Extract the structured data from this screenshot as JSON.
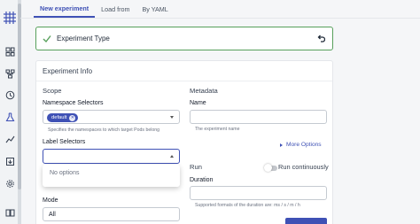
{
  "rail": {
    "icons": [
      "logo-grid-icon",
      "dashboard-icon",
      "workflow-icon",
      "schedule-icon",
      "flask-icon",
      "chart-line-icon",
      "archive-icon",
      "gear-icon",
      "book-icon"
    ]
  },
  "tabs": [
    {
      "label": "New experiment",
      "active": true
    },
    {
      "label": "Load from",
      "active": false
    },
    {
      "label": "By YAML",
      "active": false
    }
  ],
  "step": {
    "title": "Experiment Type"
  },
  "info": {
    "heading": "Experiment Info",
    "scope": {
      "heading": "Scope",
      "namespace_selectors": {
        "label": "Namespace Selectors",
        "chip": "default",
        "helper": "Specifies the namespaces to which target Pods belong"
      },
      "label_selectors": {
        "label": "Label Selectors",
        "dropdown_option": "No options"
      },
      "mode": {
        "label": "Mode",
        "value": "All"
      }
    },
    "metadata": {
      "heading": "Metadata",
      "name": {
        "label": "Name",
        "helper": "The experiment name"
      },
      "more_options": "More Options"
    },
    "run": {
      "heading": "Run",
      "toggle_label": "Run continuously",
      "duration": {
        "label": "Duration",
        "helper": "Supported formats of the duration are: ms / s / m / h"
      }
    },
    "ghost_text": "More Options"
  },
  "colors": {
    "accent": "#3f51b5",
    "success": "#57a05b"
  }
}
